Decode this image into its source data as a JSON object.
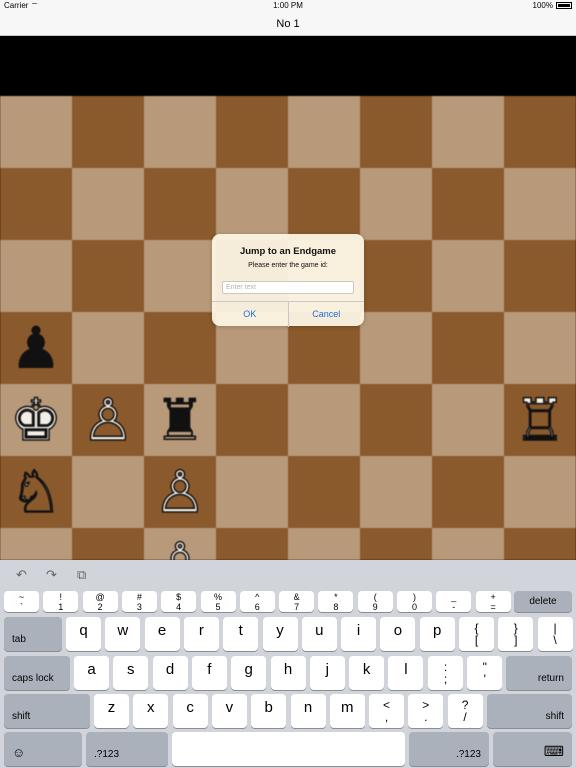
{
  "status_bar": {
    "carrier": "Carrier",
    "wifi_icon": "wifi-icon",
    "time": "1:00 PM",
    "battery": "100%"
  },
  "nav": {
    "title": "No 1"
  },
  "board": {
    "light_color": "#b89a7a",
    "dark_color": "#8a5a2c",
    "pieces": [
      {
        "row": 3,
        "col": 0,
        "glyph": "♟",
        "color": "black",
        "name": "black-pawn"
      },
      {
        "row": 4,
        "col": 0,
        "glyph": "♚",
        "color": "white",
        "name": "white-king"
      },
      {
        "row": 4,
        "col": 1,
        "glyph": "♙",
        "color": "white",
        "name": "white-pawn"
      },
      {
        "row": 4,
        "col": 2,
        "glyph": "♜",
        "color": "black",
        "name": "black-rook"
      },
      {
        "row": 4,
        "col": 7,
        "glyph": "♖",
        "color": "white",
        "name": "white-rook"
      },
      {
        "row": 5,
        "col": 0,
        "glyph": "♘",
        "color": "white",
        "name": "white-knight"
      },
      {
        "row": 5,
        "col": 2,
        "glyph": "♙",
        "color": "white",
        "name": "white-pawn"
      },
      {
        "row": 6,
        "col": 2,
        "glyph": "♙",
        "color": "white",
        "name": "white-pawn"
      }
    ]
  },
  "dialog": {
    "title": "Jump to an Endgame",
    "message": "Please enter the game id:",
    "input_placeholder": "Enter text",
    "ok": "OK",
    "cancel": "Cancel",
    "accent": "#1a6fd9"
  },
  "keyboard": {
    "tools": {
      "undo": "↶",
      "redo": "↷",
      "paste": "⧉"
    },
    "row1": [
      {
        "top": "~",
        "bottom": "`"
      },
      {
        "top": "!",
        "bottom": "1"
      },
      {
        "top": "@",
        "bottom": "2"
      },
      {
        "top": "#",
        "bottom": "3"
      },
      {
        "top": "$",
        "bottom": "4"
      },
      {
        "top": "%",
        "bottom": "5"
      },
      {
        "top": "^",
        "bottom": "6"
      },
      {
        "top": "&",
        "bottom": "7"
      },
      {
        "top": "*",
        "bottom": "8"
      },
      {
        "top": "(",
        "bottom": "9"
      },
      {
        "top": ")",
        "bottom": "0"
      },
      {
        "top": "_",
        "bottom": "-"
      },
      {
        "top": "+",
        "bottom": "="
      }
    ],
    "delete": "delete",
    "tab": "tab",
    "row2_letters": [
      "q",
      "w",
      "e",
      "r",
      "t",
      "y",
      "u",
      "i",
      "o",
      "p"
    ],
    "row2_symbols": [
      {
        "top": "{",
        "bottom": "["
      },
      {
        "top": "}",
        "bottom": "]"
      },
      {
        "top": "|",
        "bottom": "\\"
      }
    ],
    "caps_lock": "caps lock",
    "row3_letters": [
      "a",
      "s",
      "d",
      "f",
      "g",
      "h",
      "j",
      "k",
      "l"
    ],
    "row3_symbols": [
      {
        "top": ":",
        "bottom": ";"
      },
      {
        "top": "\"",
        "bottom": "'"
      }
    ],
    "return": "return",
    "shift": "shift",
    "row4_letters": [
      "z",
      "x",
      "c",
      "v",
      "b",
      "n",
      "m"
    ],
    "row4_symbols": [
      {
        "top": "<",
        "bottom": ","
      },
      {
        "top": ">",
        "bottom": "."
      },
      {
        "top": "?",
        "bottom": "/"
      }
    ],
    "emoji": "☺",
    "numbers": ".?123",
    "space": "",
    "hide_keyboard": "⌨"
  }
}
